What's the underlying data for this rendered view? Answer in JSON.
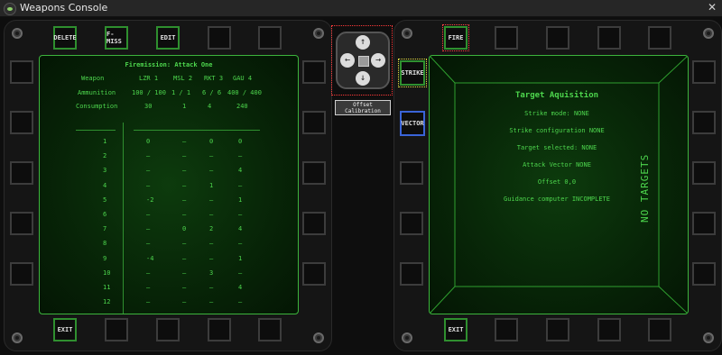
{
  "window": {
    "title": "Weapons Console",
    "close_glyph": "✕"
  },
  "left": {
    "top_buttons": [
      "DELETE",
      "F-MISS",
      "EDIT"
    ],
    "bottom_buttons": [
      "EXIT"
    ],
    "screen": {
      "title": "Firemission: Attack One",
      "header": [
        "Weapon",
        "LZR 1",
        "MSL 2",
        "RKT 3",
        "GAU 4"
      ],
      "ammunition": [
        "Ammunition",
        "100 / 100",
        "1 / 1",
        "6 / 6",
        "400 / 400"
      ],
      "consumption": [
        "Consumption",
        "30",
        "1",
        "4",
        "240"
      ],
      "rows": [
        [
          "1",
          "0",
          "–",
          "0",
          "0"
        ],
        [
          "2",
          "–",
          "–",
          "–",
          "–"
        ],
        [
          "3",
          "–",
          "–",
          "–",
          "4"
        ],
        [
          "4",
          "–",
          "–",
          "1",
          "–"
        ],
        [
          "5",
          "-2",
          "–",
          "–",
          "1"
        ],
        [
          "6",
          "–",
          "–",
          "–",
          "–"
        ],
        [
          "7",
          "–",
          "0",
          "2",
          "4"
        ],
        [
          "8",
          "–",
          "–",
          "–",
          "–"
        ],
        [
          "9",
          "-4",
          "–",
          "–",
          "1"
        ],
        [
          "10",
          "–",
          "–",
          "3",
          "–"
        ],
        [
          "11",
          "–",
          "–",
          "–",
          "4"
        ],
        [
          "12",
          "–",
          "–",
          "–",
          "–"
        ]
      ]
    }
  },
  "center": {
    "offset_button": "Offset Calibration",
    "arrows": {
      "up": "↑",
      "down": "↓",
      "left": "←",
      "right": "→"
    }
  },
  "right": {
    "top_buttons": [
      "FIRE"
    ],
    "side_buttons": [
      "STRIKE",
      "VECTOR"
    ],
    "bottom_buttons": [
      "EXIT"
    ],
    "screen": {
      "title": "Target Aquisition",
      "lines": [
        "Strike mode: NONE",
        "Strike configuration NONE",
        "Target selected: NONE",
        "Attack Vector NONE",
        "Offset 0,0",
        "Guidance computer INCOMPLETE"
      ],
      "status": "NO TARGETS"
    }
  },
  "colors": {
    "screen_green": "#4dd64d",
    "frame_green": "#3cb43c",
    "highlight_red": "#ff3a3a",
    "highlight_yellow": "#e0e040",
    "highlight_blue": "#3a64d8"
  }
}
